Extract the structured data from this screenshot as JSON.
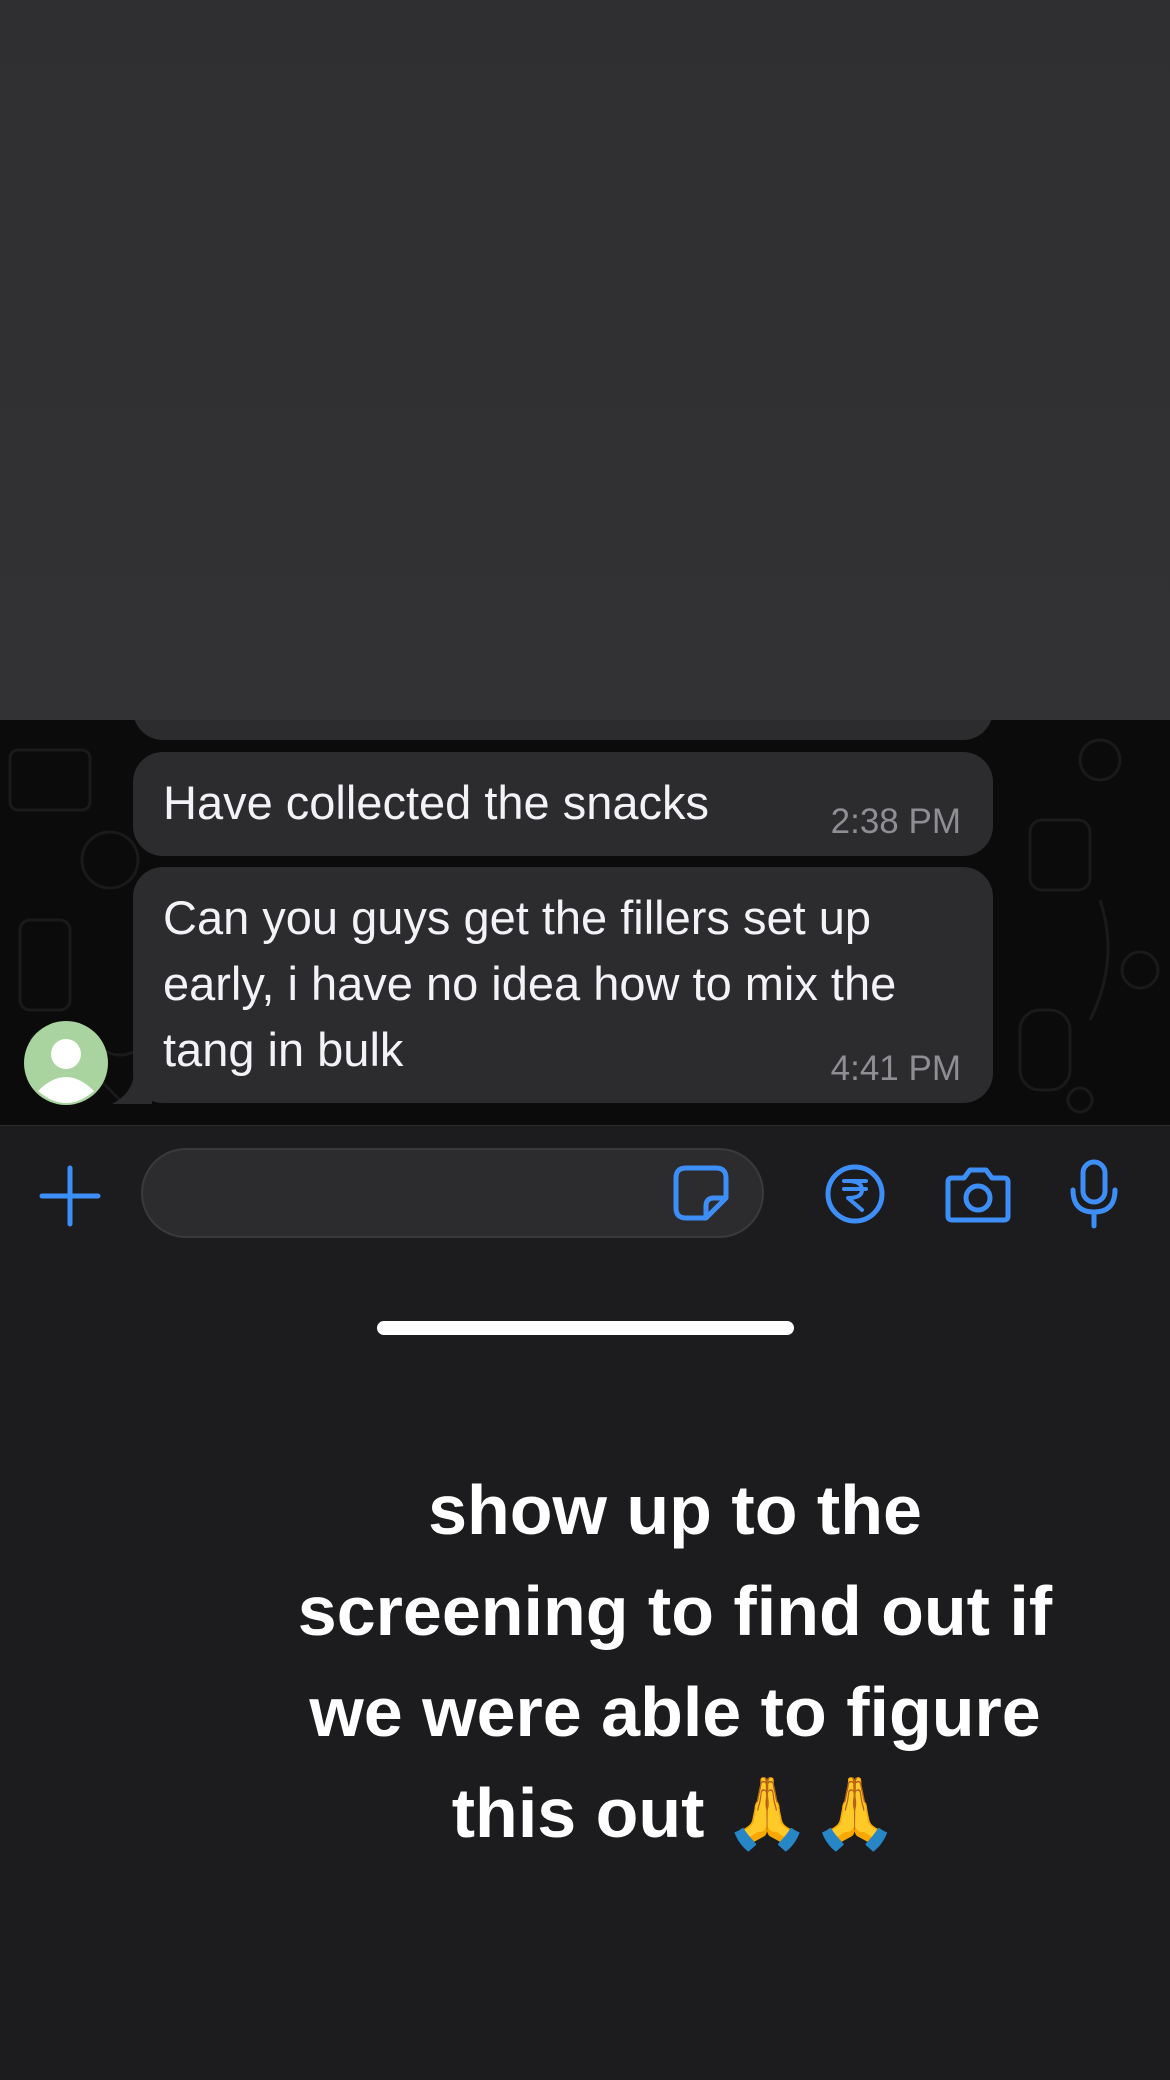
{
  "messages": [
    {
      "text": "Have collected the snacks",
      "time": "2:38 PM"
    },
    {
      "text_lines": [
        "Can you guys get the fillers set up",
        "early, i have no idea how to mix the",
        "tang in bulk"
      ],
      "time": "4:41 PM"
    }
  ],
  "icons": {
    "attach": "plus-icon",
    "sticker": "sticker-icon",
    "payment": "rupee-icon",
    "camera": "camera-icon",
    "voice": "microphone-icon",
    "avatar": "default-avatar-icon"
  },
  "caption": {
    "lines": [
      "show up to the",
      "screening to find out if",
      "we were able to figure",
      "this out 🙏🙏"
    ]
  },
  "colors": {
    "accent": "#3d8ef7",
    "bubble": "#2c2c2e",
    "chat_background": "#0b0b0b",
    "avatar_bg": "#a9d4a0"
  }
}
